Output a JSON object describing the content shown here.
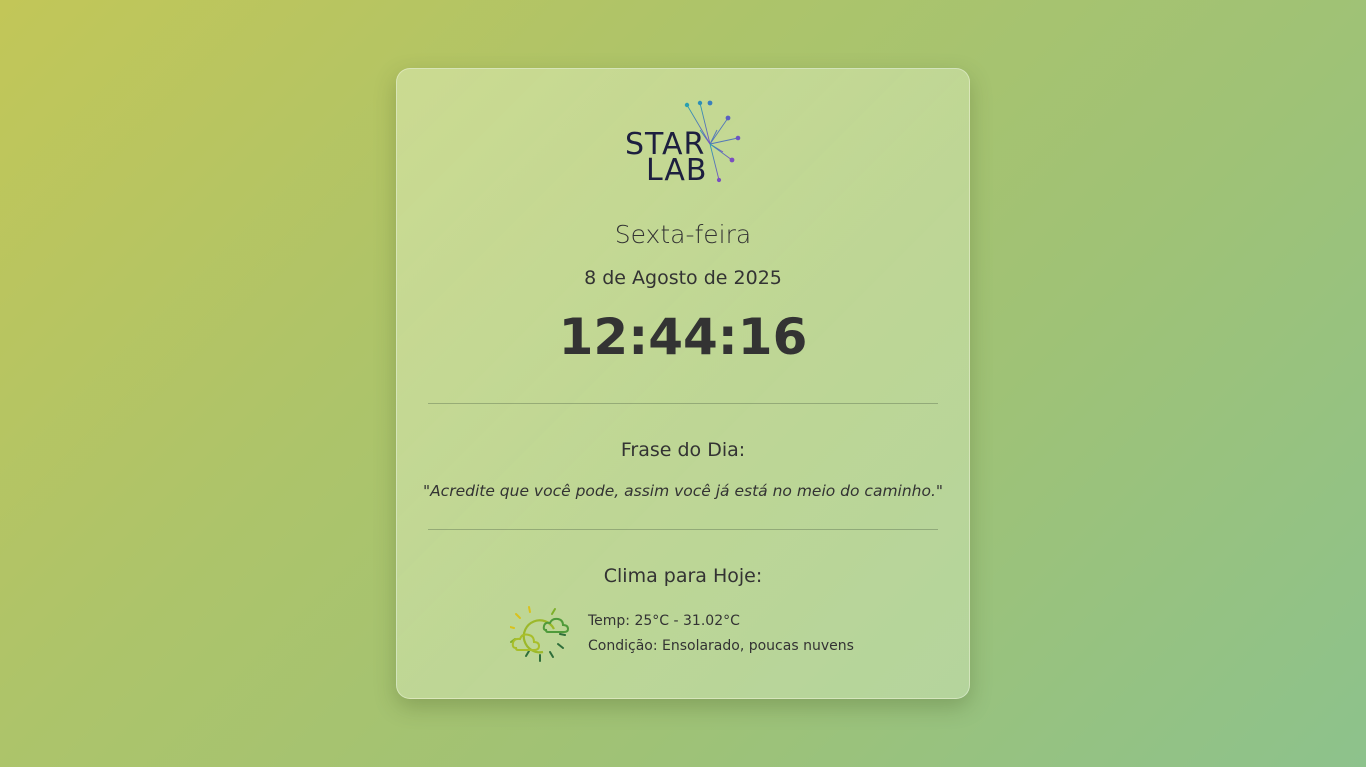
{
  "logo": {
    "line1": "STAR",
    "line2": "LAB"
  },
  "day": {
    "weekday": "Sexta-feira",
    "date": "8 de Agosto de 2025",
    "time": "12:44:16"
  },
  "quote": {
    "title": "Frase do Dia:",
    "text": "\"Acredite que você pode, assim você já está no meio do caminho.\""
  },
  "weather": {
    "title": "Clima para Hoje:",
    "icon": "partly-sunny-icon",
    "temp": "Temp: 25°C - 31.02°C",
    "condition": "Condição: Ensolarado, poucas nuvens"
  },
  "colors": {
    "text": "#333333",
    "logo_text": "#1d1f3f",
    "logo_accent_teal": "#2a9fb0",
    "logo_accent_purple": "#7a4fc0",
    "weather_yellow": "#d9c21c",
    "weather_green": "#5aa23a",
    "weather_dark": "#2f6e3a"
  }
}
